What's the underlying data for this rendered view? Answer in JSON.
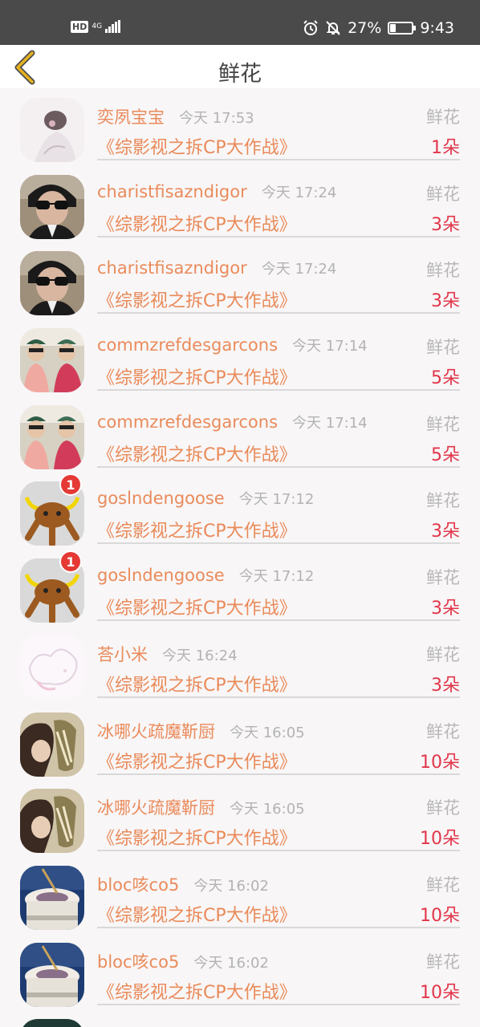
{
  "status_bar": {
    "hd": "HD",
    "network": "4G",
    "battery_pct_text": "27%",
    "battery_level": 0.27,
    "time": "9:43"
  },
  "header": {
    "back_icon": "chevron-left-icon",
    "title": "鲜花"
  },
  "rows": [
    {
      "user": "奕夙宝宝",
      "time": "今天 17:53",
      "gift": "鲜花",
      "title": "《综影视之拆CP大作战》",
      "count": "1朵",
      "avatar": "portrait-light",
      "badge": ""
    },
    {
      "user": "charistfisazndigor",
      "time": "今天 17:24",
      "gift": "鲜花",
      "title": "《综影视之拆CP大作战》",
      "count": "3朵",
      "avatar": "sunglasses",
      "badge": ""
    },
    {
      "user": "charistfisazndigor",
      "time": "今天 17:24",
      "gift": "鲜花",
      "title": "《综影视之拆CP大作战》",
      "count": "3朵",
      "avatar": "sunglasses",
      "badge": ""
    },
    {
      "user": "commzrefdesgarcons",
      "time": "今天 17:14",
      "gift": "鲜花",
      "title": "《综影视之拆CP大作战》",
      "count": "5朵",
      "avatar": "two-people",
      "badge": ""
    },
    {
      "user": "commzrefdesgarcons",
      "time": "今天 17:14",
      "gift": "鲜花",
      "title": "《综影视之拆CP大作战》",
      "count": "5朵",
      "avatar": "two-people",
      "badge": ""
    },
    {
      "user": "goslndengoose",
      "time": "今天 17:12",
      "gift": "鲜花",
      "title": "《综影视之拆CP大作战》",
      "count": "3朵",
      "avatar": "bull-toy",
      "badge": "1"
    },
    {
      "user": "goslndengoose",
      "time": "今天 17:12",
      "gift": "鲜花",
      "title": "《综影视之拆CP大作战》",
      "count": "3朵",
      "avatar": "bull-toy",
      "badge": "1"
    },
    {
      "user": "荅小米",
      "time": "今天 16:24",
      "gift": "鲜花",
      "title": "《综影视之拆CP大作战》",
      "count": "3朵",
      "avatar": "sketch",
      "badge": ""
    },
    {
      "user": "冰哪火疏魔靳厨",
      "time": "今天 16:05",
      "gift": "鲜花",
      "title": "《综影视之拆CP大作战》",
      "count": "10朵",
      "avatar": "anime",
      "badge": ""
    },
    {
      "user": "冰哪火疏魔靳厨",
      "time": "今天 16:05",
      "gift": "鲜花",
      "title": "《综影视之拆CP大作战》",
      "count": "10朵",
      "avatar": "anime",
      "badge": ""
    },
    {
      "user": "bloc咳co5",
      "time": "今天 16:02",
      "gift": "鲜花",
      "title": "《综影视之拆CP大作战》",
      "count": "10朵",
      "avatar": "coffee",
      "badge": ""
    },
    {
      "user": "bloc咳co5",
      "time": "今天 16:02",
      "gift": "鲜花",
      "title": "《综影视之拆CP大作战》",
      "count": "10朵",
      "avatar": "coffee",
      "badge": ""
    }
  ],
  "colors": {
    "username": "#ea8b5b",
    "count": "#e2364a",
    "muted": "#b3b3b3",
    "back_icon": "#e5b21f"
  }
}
